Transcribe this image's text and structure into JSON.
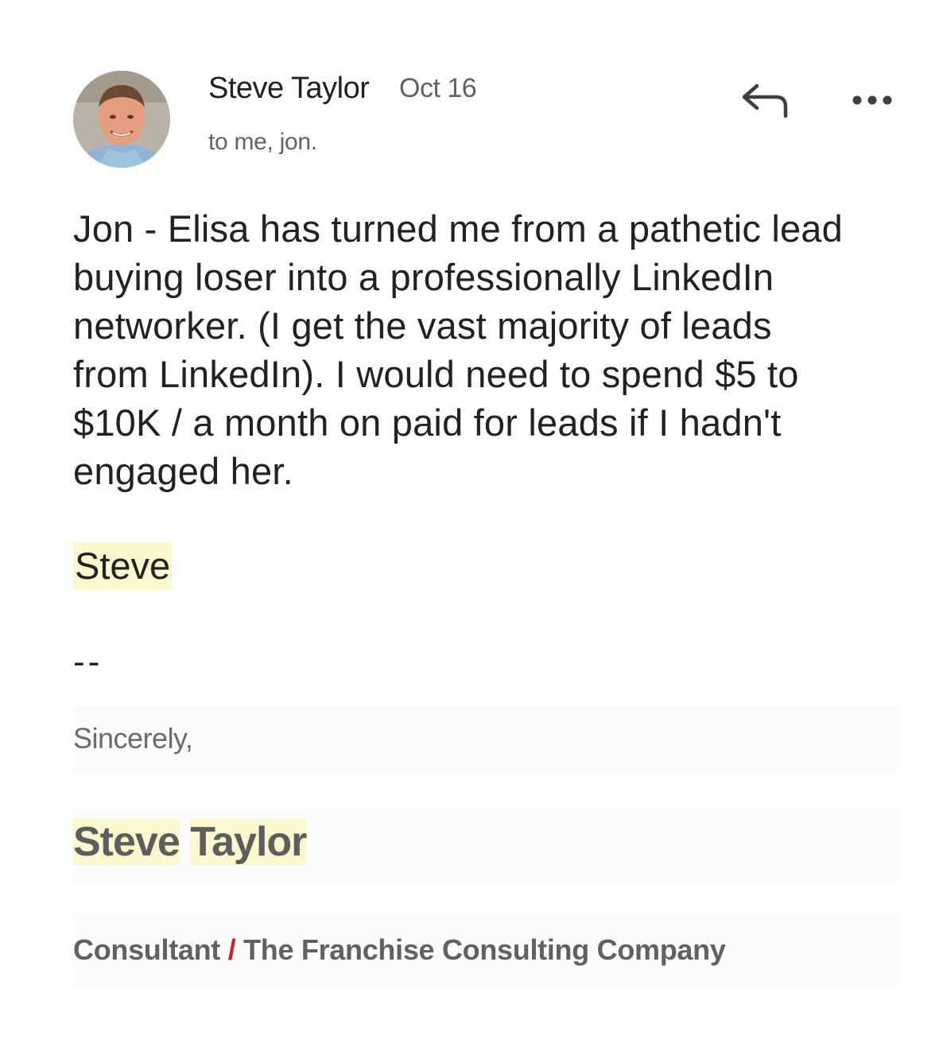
{
  "header": {
    "sender_name": "Steve Taylor",
    "date": "Oct 16",
    "recipients": "to me, jon.",
    "avatar_icon": "user-photo-avatar",
    "reply_icon": "reply-arrow-icon",
    "more_icon": "more-dots-icon"
  },
  "body": {
    "message": "Jon - Elisa has turned me from a pathetic lead\nbuying loser into a professionally LinkedIn\nnetworker.  (I get the vast majority of leads\nfrom LinkedIn).  I would need to spend $5 to\n$10K / a month on paid for leads if I  hadn't\nengaged her.",
    "sign_off": "Steve",
    "separator": "--"
  },
  "signature": {
    "closing": "Sincerely,",
    "first_name": "Steve",
    "last_name": "Taylor",
    "role": "Consultant",
    "divider": "/",
    "company": "The Franchise Consulting Company"
  },
  "colors": {
    "highlight": "#fbf8cf",
    "divider_accent": "#d21f1f",
    "muted_text": "#5f6368"
  }
}
